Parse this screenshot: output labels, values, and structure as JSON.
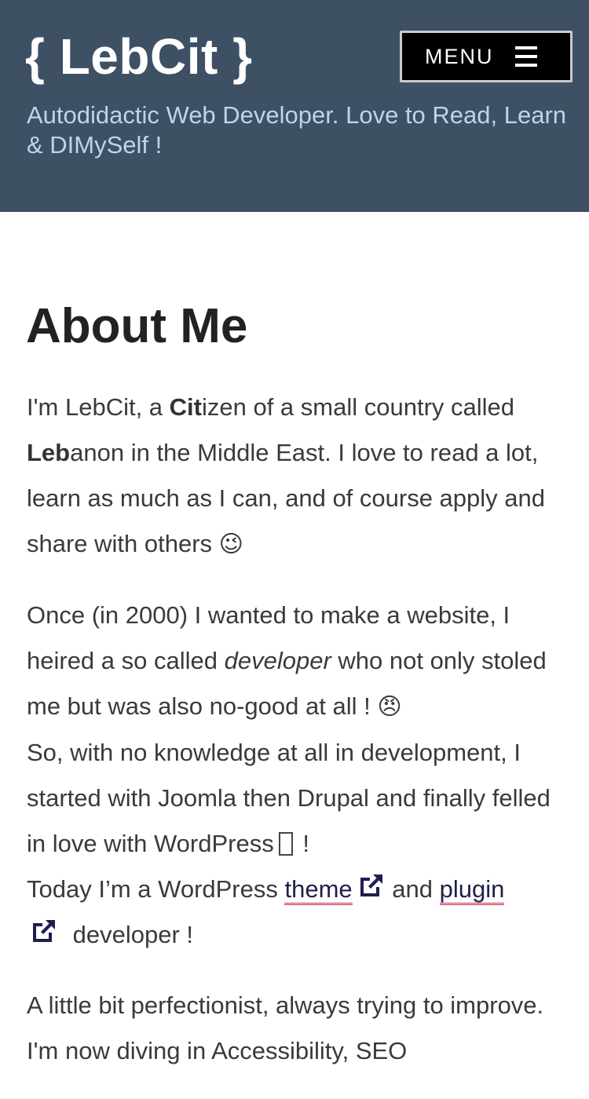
{
  "header": {
    "site_title": "{ LebCit }",
    "tagline": "Autodidactic Web Developer. Love to Read, Learn & DIMySelf !",
    "menu_label": "MENU"
  },
  "page": {
    "title": "About Me"
  },
  "content": {
    "p1": {
      "t1": "I'm LebCit, a ",
      "b1": "Cit",
      "t2": "izen of a small country called ",
      "b2": "Leb",
      "t3": "anon in the Middle East. I love to read a lot, learn as much as I can, and of course apply and share with others ",
      "emoji": "😉"
    },
    "p2": {
      "t1": "Once (in 2000) I wanted to make a website, I heired a so called ",
      "em": "developer",
      "t2": " who not only stoled me but was also no-good at all ! ",
      "emoji": "😠",
      "t3": "So, with no knowledge at all in development, I started with Joomla then Drupal and finally felled in love with WordPress",
      "t4": " !",
      "t5": "Today I’m a WordPress ",
      "link_theme": "theme",
      "t6": " and ",
      "link_plugin": "plugin",
      "t7": " developer !"
    },
    "p3": {
      "t1": "A little bit perfectionist, always trying to improve. I'm now diving in Accessibility, SEO"
    }
  },
  "colors": {
    "header_bg": "#3e5064",
    "tagline": "#b9d6ea",
    "link_underline": "#c7254e"
  }
}
